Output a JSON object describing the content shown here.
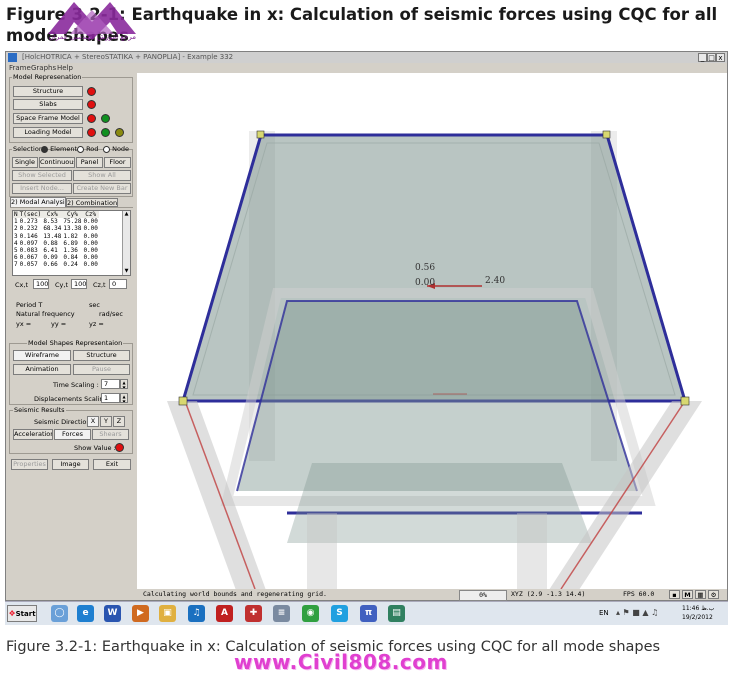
{
  "figure": {
    "top_caption": "Figure 3.2-1: Earthquake in x: Calculation of seismic forces using CQC for all mode shapes",
    "bottom_caption": "Figure 3.2-1: Earthquake in x: Calculation of seismic forces using CQC for all mode shapes",
    "watermark": "www.Civil808.com",
    "logo_text": "مرجع آموزش مهندسی عمران",
    "brand_color": "#8a2a9c"
  },
  "window": {
    "title": "[HolcHOTRICA + StereoSTATIKA + PANOPLIA] - Example 332",
    "controls": [
      "_",
      "□",
      "x"
    ]
  },
  "menu": [
    "Frame",
    "Graphs",
    "Help"
  ],
  "model_representation": {
    "heading": "Model Represenation",
    "rows": [
      {
        "label": "Structure",
        "dots": [
          "#e01010"
        ]
      },
      {
        "label": "Slabs",
        "dots": [
          "#e01010"
        ]
      },
      {
        "label": "Space Frame Model",
        "dots": [
          "#e01010",
          "#109020"
        ]
      },
      {
        "label": "Loading Model",
        "dots": [
          "#e01010",
          "#109020",
          "#8a8a10"
        ]
      }
    ]
  },
  "selection": {
    "heading": "Selection",
    "radios": [
      "Element",
      "Rod",
      "Node"
    ],
    "selected": "Element",
    "buttons": [
      "Single",
      "Continuous",
      "Panel",
      "Floor"
    ],
    "show_selected": "Show Selected",
    "show_all": "Show All",
    "insert_node": "Insert Node...",
    "create_bar": "Create New Bar"
  },
  "tabs": [
    "2) Modal Analysis",
    "2) Combinations"
  ],
  "active_tab": "2) Modal Analysis",
  "modal_table": {
    "headers": [
      "N",
      "T(sec)",
      "Cx%",
      "Cy%",
      "Cz%"
    ],
    "rows": [
      [
        "1",
        "0.273",
        "8.53",
        "75.28",
        "0.00"
      ],
      [
        "2",
        "0.232",
        "68.34",
        "13.38",
        "0.00"
      ],
      [
        "3",
        "0.146",
        "13.48",
        "1.82",
        "0.00"
      ],
      [
        "4",
        "0.097",
        "0.88",
        "6.89",
        "0.00"
      ],
      [
        "5",
        "0.083",
        "6.41",
        "1.36",
        "0.00"
      ],
      [
        "6",
        "0.067",
        "0.09",
        "0.84",
        "0.00"
      ],
      [
        "7",
        "0.057",
        "0.66",
        "0.24",
        "0.00"
      ]
    ]
  },
  "totals": {
    "cx_label": "Cx,t",
    "cx_value": "100",
    "cy_label": "Cy,t",
    "cy_value": "100",
    "cz_label": "Cz,t",
    "cz_value": "0"
  },
  "period": {
    "period_label": "Period T",
    "period_unit": "sec",
    "freq_label": "Natural frequency",
    "freq_unit": "rad/sec",
    "yx": "yx =",
    "yy": "yy =",
    "yz": "yz ="
  },
  "model_shapes": {
    "heading": "Model Shapes Representaion",
    "wireframe": "Wireframe",
    "structure": "Structure",
    "animation": "Animation",
    "pause": "Pause",
    "time_scaling_label": "Time Scaling :",
    "time_scaling_value": "7",
    "disp_scaling_label": "Displacements Scaling :",
    "disp_scaling_value": "1"
  },
  "seismic_results": {
    "heading": "Seismic Results",
    "direction_label": "Seismic Direction :",
    "directions": [
      "X",
      "Y",
      "Z"
    ],
    "accelerations": "Accelerations",
    "forces": "Forces",
    "shears": "Shears",
    "show_value_label": "Show Value :",
    "show_value_color": "#e01010"
  },
  "bottom_buttons": [
    "Properties",
    "Image",
    "Exit"
  ],
  "viewport": {
    "label_056": "0.56",
    "label_000": "0.00",
    "label_240": "2.40",
    "slab_color": "#7f9690",
    "beam_color": "#2e2e9a",
    "column_color": "#c0c0c0"
  },
  "status": {
    "message": "Calculating world bounds and regenerating grid.",
    "percent": "0%",
    "xyz": "XYZ (2.9 -1.3 14.4)",
    "fps": "FPS  60.0",
    "mode_button": "M"
  },
  "taskbar": {
    "start": "Start",
    "language": "EN",
    "time": "11:46 ب.ظ",
    "date": "19/2/2012"
  }
}
